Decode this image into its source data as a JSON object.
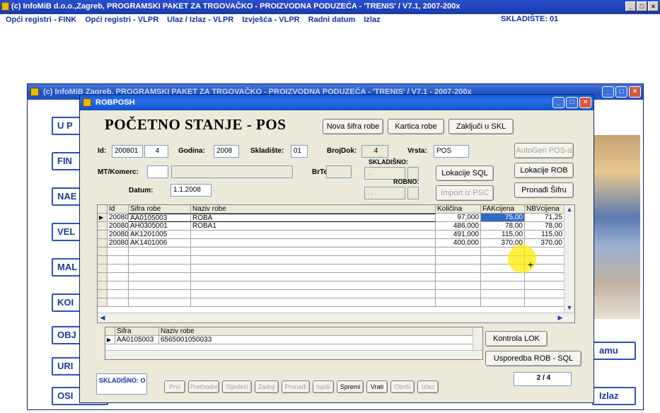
{
  "app": {
    "title": "(c) InfoMiB d.o.o.,Zagreb, PROGRAMSKI PAKET ZA TRGOVAČKO - PROIZVODNA PODUZEĆA - 'TRENIS' / V7.1, 2007-200x",
    "menu": [
      "Opći registri - FINK",
      "Opći registri - VLPR",
      "Ulaz / Izlaz - VLPR",
      "Izvješća - VLPR",
      "Radni datum",
      "Izlaz"
    ],
    "skladiste": "SKLADIŠTE: 01",
    "window_buttons": [
      "_",
      "□",
      "×"
    ]
  },
  "bg_window": {
    "title": "(c) InfoMiB Zagreb, PROGRAMSKI PAKET ZA TRGOVAČKO - PROIZVODNA PODUZEĆA - 'TRENIS' / V7.1 - 2007-200x",
    "left_buttons": [
      "U P",
      "FIN",
      "NAE",
      "VEL",
      "MAL",
      "KOI",
      "OBJ",
      "URI",
      "OSI"
    ],
    "right_buttons": [
      "amu",
      "Izlaz"
    ]
  },
  "dialog": {
    "title": "ROBPOSH",
    "heading": "POČETNO STANJE - POS",
    "top_buttons": [
      "Nova šifra robe",
      "Kartica robe",
      "Zaključi u SKL"
    ],
    "fields": {
      "id_label": "Id:",
      "id_value": "200801",
      "id_num": "4",
      "godina_label": "Godina:",
      "godina_value": "2008",
      "skladiste_label": "Skladište:",
      "skladiste_value": "01",
      "brojdok_label": "BrojDok:",
      "brojdok_value": "4",
      "vrsta_label": "Vrsta:",
      "vrsta_value": "POS",
      "mt_label": "MT/Komerc:",
      "brte_label": "BrTe:",
      "datum_label": "Datum:",
      "datum_value": "1.1.2008",
      "skladisno_label": "SKLADIŠNO:",
      "skladisno_value": ". .",
      "robno_label": "ROBNO:",
      "robno_value": ". ."
    },
    "side_buttons": {
      "lokacije_sql": "Lokacije SQL",
      "import_psc": "Import iz PSC",
      "autogen": "AutoGen POS-a",
      "lokacije_rob": "Lokacije ROB",
      "pronadi_sifru": "Pronađi Šifru",
      "kontrola_lok": "Kontrola LOK",
      "usporedba": "Usporedba ROB - SQL"
    },
    "grid": {
      "headers": [
        "Id",
        "Šifra robe",
        "Naziv robe",
        "Količina",
        "FAKcijena",
        "NBVcijena"
      ],
      "rows": [
        [
          "20080",
          "AA0105003",
          "ROBA",
          "97,000",
          "75,00",
          "71,25"
        ],
        [
          "20080",
          "AH0305001",
          "ROBA1",
          "486,000",
          "78,00",
          "78,00"
        ],
        [
          "20080",
          "AK1201005",
          "",
          "491,000",
          "115,00",
          "115,00"
        ],
        [
          "20080",
          "AK1401006",
          "",
          "400,000",
          "370,00",
          "370,00"
        ]
      ]
    },
    "subgrid": {
      "headers": [
        "Šifra",
        "Naziv robe"
      ],
      "rows": [
        [
          "AA0105003",
          "6565001050033"
        ]
      ]
    },
    "footer": {
      "skladisno": "SKLADIŠNO: O",
      "nav": [
        "Prvi",
        "Prethodni",
        "Sljedeći",
        "Zadnji",
        "Pronađi",
        "Ispiši",
        "Spremi",
        "Vrati",
        "Obriši",
        "Izlaz"
      ],
      "counter": "2 / 4"
    }
  }
}
